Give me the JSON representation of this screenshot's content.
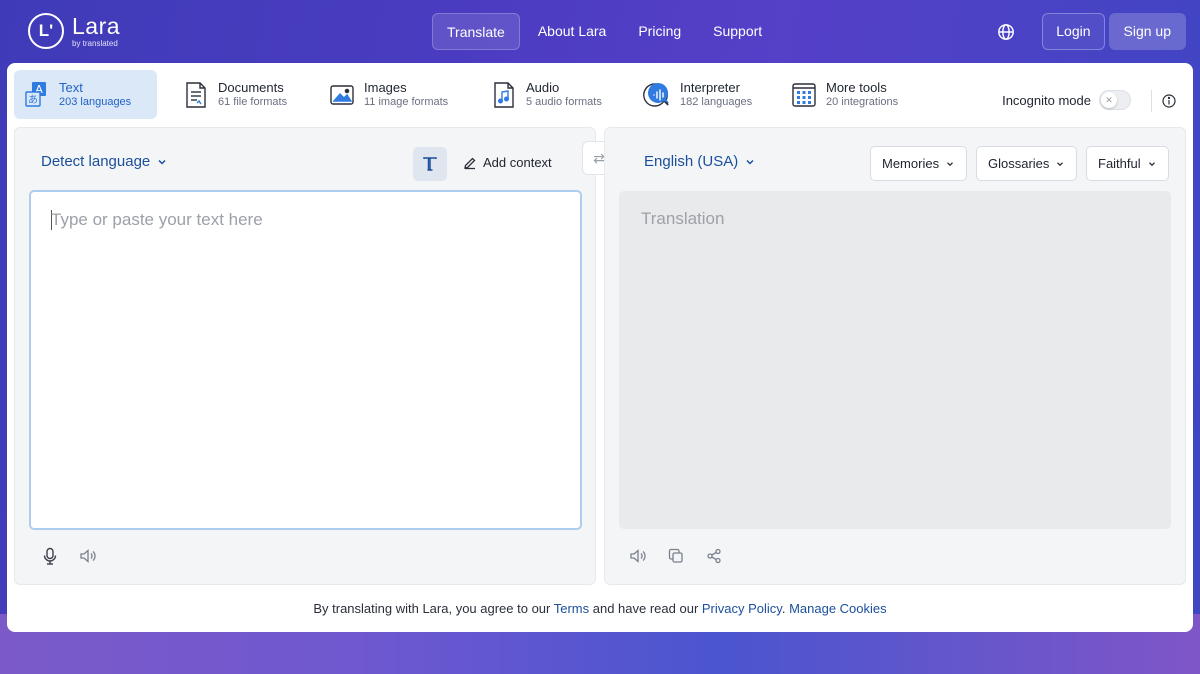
{
  "brand": {
    "name": "Lara",
    "sub": "by translated",
    "logo_glyph": "L'"
  },
  "nav": {
    "links": [
      {
        "label": "Translate",
        "active": true
      },
      {
        "label": "About Lara",
        "active": false
      },
      {
        "label": "Pricing",
        "active": false
      },
      {
        "label": "Support",
        "active": false
      }
    ],
    "globe_icon": "globe-icon",
    "login": "Login",
    "signup": "Sign up"
  },
  "tabs": [
    {
      "title": "Text",
      "sub": "203 languages",
      "icon": "text-translate-icon",
      "active": true
    },
    {
      "title": "Documents",
      "sub": "61 file formats",
      "icon": "document-icon",
      "active": false
    },
    {
      "title": "Images",
      "sub": "11 image formats",
      "icon": "image-icon",
      "active": false
    },
    {
      "title": "Audio",
      "sub": "5 audio formats",
      "icon": "audio-file-icon",
      "active": false
    },
    {
      "title": "Interpreter",
      "sub": "182 languages",
      "icon": "interpreter-icon",
      "active": false
    },
    {
      "title": "More tools",
      "sub": "20 integrations",
      "icon": "grid-tools-icon",
      "active": false
    }
  ],
  "incognito": {
    "label": "Incognito mode",
    "enabled": false,
    "knob_glyph": "✕"
  },
  "source": {
    "language": "Detect language",
    "add_context": "Add context",
    "placeholder": "Type or paste your text here"
  },
  "swap_glyph": "⇄",
  "target": {
    "language": "English (USA)",
    "memories": "Memories",
    "glossaries": "Glossaries",
    "style": "Faithful",
    "placeholder": "Translation"
  },
  "footer": {
    "prefix": "By translating with Lara, you agree to our ",
    "terms": "Terms",
    "middle": " and have read our ",
    "privacy": "Privacy Policy",
    "sep": ". ",
    "cookies": "Manage Cookies"
  },
  "colors": {
    "accent": "#1f63c7",
    "link": "#1b4f9c",
    "active_tab_bg": "#dbe8f7"
  }
}
